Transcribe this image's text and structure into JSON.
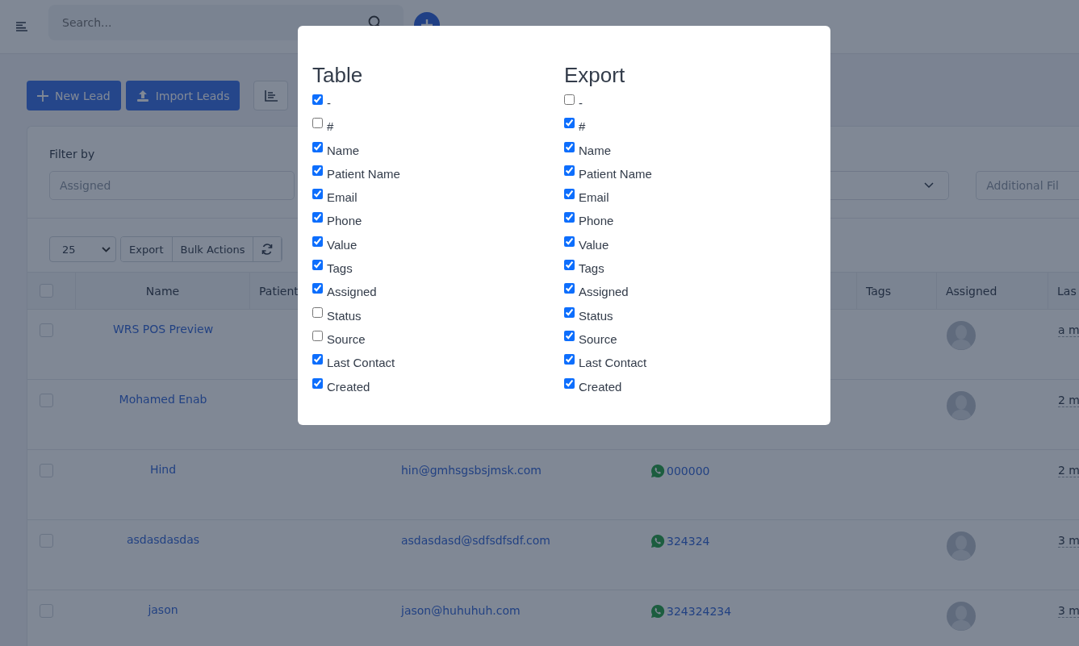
{
  "header": {
    "search": {
      "placeholder": "Search..."
    }
  },
  "toolbar": {
    "buttons": [
      {
        "label": "New Lead",
        "kind": "add"
      },
      {
        "label": "Import Leads",
        "kind": "upload"
      }
    ]
  },
  "filters": {
    "label": "Filter by",
    "assigned": {
      "placeholder": "Assigned"
    },
    "additional": {
      "placeholder": "Additional Fil"
    }
  },
  "table_controls": {
    "page_size": "25",
    "buttons": [
      "Export",
      "Bulk Actions"
    ]
  },
  "table": {
    "select_all": {
      "checked": false
    },
    "columns": [
      "Name",
      "Patient",
      "Tags",
      "Assigned",
      "Las"
    ],
    "rows": [
      {
        "selected": false,
        "name": "WRS POS Preview",
        "avatar": true,
        "last_contact": "a m"
      },
      {
        "selected": false,
        "name": "Mohamed Enab",
        "avatar": true,
        "last_contact": "2 m"
      },
      {
        "selected": false,
        "name": "Hind",
        "email": "hin@gmhsgsbsjmsk.com",
        "phone": "000000",
        "avatar": false,
        "last_contact": "2 m"
      },
      {
        "selected": false,
        "name": "asdasdasdas",
        "email": "asdasdasd@sdfsdfsdf.com",
        "phone": "324324",
        "avatar": true,
        "last_contact": "3 m"
      },
      {
        "selected": false,
        "name": "jason",
        "email": "jason@huhuhuh.com",
        "phone": "324324234",
        "avatar": true,
        "last_contact": "3 m"
      }
    ]
  },
  "modal": {
    "groups": [
      {
        "title": "Table",
        "options": [
          {
            "label": "-",
            "checked": true
          },
          {
            "label": "#",
            "checked": false
          },
          {
            "label": "Name",
            "checked": true
          },
          {
            "label": "Patient Name",
            "checked": true
          },
          {
            "label": "Email",
            "checked": true
          },
          {
            "label": "Phone",
            "checked": true
          },
          {
            "label": "Value",
            "checked": true
          },
          {
            "label": "Tags",
            "checked": true
          },
          {
            "label": "Assigned",
            "checked": true
          },
          {
            "label": "Status",
            "checked": false
          },
          {
            "label": "Source",
            "checked": false
          },
          {
            "label": "Last Contact",
            "checked": true
          },
          {
            "label": "Created",
            "checked": true
          }
        ]
      },
      {
        "title": "Export",
        "options": [
          {
            "label": "-",
            "checked": false
          },
          {
            "label": "#",
            "checked": true
          },
          {
            "label": "Name",
            "checked": true
          },
          {
            "label": "Patient Name",
            "checked": true
          },
          {
            "label": "Email",
            "checked": true
          },
          {
            "label": "Phone",
            "checked": true
          },
          {
            "label": "Value",
            "checked": true
          },
          {
            "label": "Tags",
            "checked": true
          },
          {
            "label": "Assigned",
            "checked": true
          },
          {
            "label": "Status",
            "checked": true
          },
          {
            "label": "Source",
            "checked": true
          },
          {
            "label": "Last Contact",
            "checked": true
          },
          {
            "label": "Created",
            "checked": true
          }
        ]
      }
    ]
  }
}
